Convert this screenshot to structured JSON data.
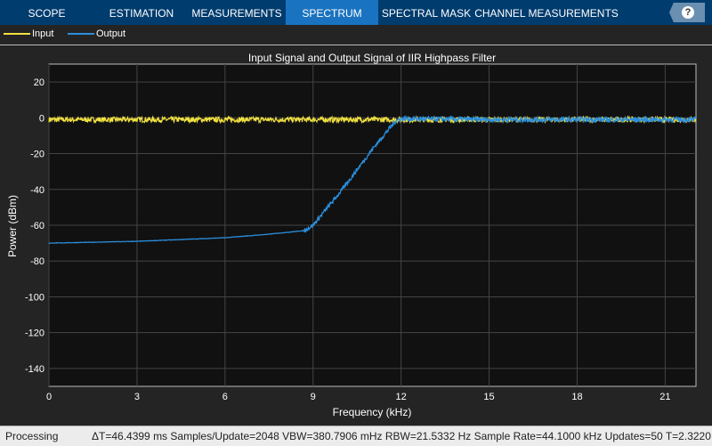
{
  "tabs": [
    {
      "label": "SCOPE",
      "active": false
    },
    {
      "label": "ESTIMATION",
      "active": false
    },
    {
      "label": "MEASUREMENTS",
      "active": false
    },
    {
      "label": "SPECTRUM",
      "active": true
    },
    {
      "label": "SPECTRAL MASK",
      "active": false
    },
    {
      "label": "CHANNEL MEASUREMENTS",
      "active": false
    }
  ],
  "help": {
    "label": "?",
    "icon": "help-icon"
  },
  "legend": [
    {
      "name": "Input",
      "color": "#f0e040"
    },
    {
      "name": "Output",
      "color": "#2b8fde"
    }
  ],
  "chart_data": {
    "type": "line",
    "title": "Input Signal and Output Signal of IIR Highpass Filter",
    "xlabel": "Frequency (kHz)",
    "ylabel": "Power (dBm)",
    "xlim": [
      0,
      22.05
    ],
    "ylim": [
      -150,
      30
    ],
    "xticks": [
      0,
      3,
      6,
      9,
      12,
      15,
      18,
      21
    ],
    "yticks": [
      20,
      0,
      -20,
      -40,
      -60,
      -80,
      -100,
      -120,
      -140
    ],
    "grid": true,
    "series": [
      {
        "name": "Input",
        "x": [
          0,
          22.05
        ],
        "y": [
          -1,
          -1
        ]
      },
      {
        "name": "Output",
        "x": [
          0,
          3,
          6,
          7.5,
          8.7,
          9,
          10,
          11,
          11.8,
          12,
          15,
          18,
          21,
          22.05
        ],
        "y": [
          -70,
          -69,
          -67,
          -65,
          -63,
          -60,
          -40,
          -18,
          -2,
          -0.5,
          -1,
          -1,
          -1,
          -1
        ]
      }
    ]
  },
  "status": {
    "state": "Processing",
    "info": "ΔT=46.4399 ms  Samples/Update=2048  VBW=380.7906 mHz  RBW=21.5332 Hz  Sample Rate=44.1000 kHz  Updates=50  T=2.3220"
  }
}
